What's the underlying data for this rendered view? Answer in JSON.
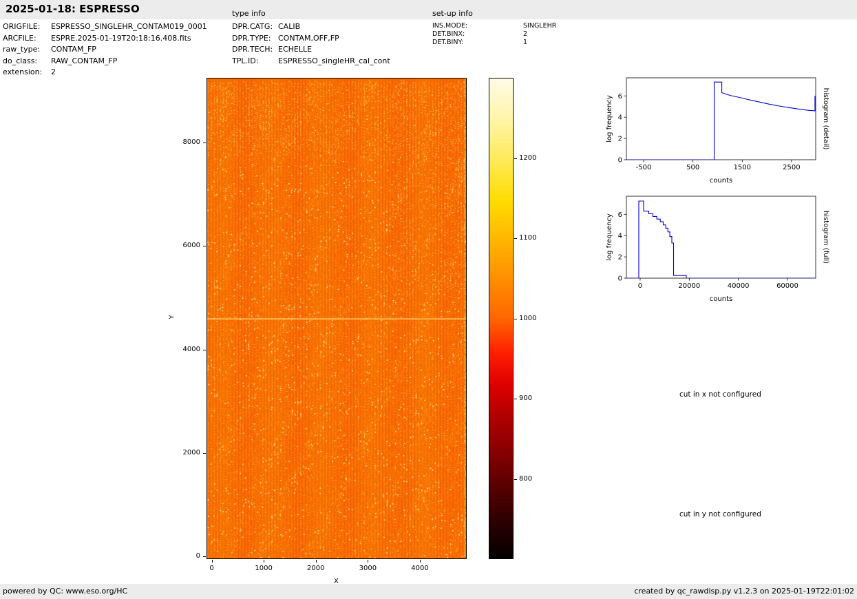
{
  "header": {
    "title": "2025-01-18: ESPRESSO",
    "type_info_label": "type info",
    "setup_info_label": "set-up info"
  },
  "meta": {
    "file_info": [
      {
        "label": "ORIGFILE:",
        "value": "ESPRESSO_SINGLEHR_CONTAM019_0001"
      },
      {
        "label": "ARCFILE:",
        "value": "ESPRE.2025-01-19T20:18:16.408.fits"
      },
      {
        "label": "raw_type:",
        "value": "CONTAM_FP"
      },
      {
        "label": "do_class:",
        "value": "RAW_CONTAM_FP"
      },
      {
        "label": "extension:",
        "value": "2"
      }
    ],
    "type_info": [
      {
        "label": "DPR.CATG:",
        "value": "CALIB"
      },
      {
        "label": "DPR.TYPE:",
        "value": "CONTAM,OFF,FP"
      },
      {
        "label": "DPR.TECH:",
        "value": "ECHELLE"
      },
      {
        "label": "TPL.ID:",
        "value": "ESPRESSO_singleHR_cal_cont"
      }
    ],
    "setup_info": [
      {
        "label": "INS.MODE:",
        "value": "SINGLEHR"
      },
      {
        "label": "DET.BINX:",
        "value": "2"
      },
      {
        "label": "DET.BINY:",
        "value": "1"
      }
    ]
  },
  "notes": {
    "cut_x": "cut in x not configured",
    "cut_y": "cut in y not configured"
  },
  "footer": {
    "left": "powered by QC: www.eso.org/HC",
    "right": "created by qc_rawdisp.py v1.2.3 on 2025-01-19T22:01:02"
  },
  "chart_data": [
    {
      "type": "heatmap",
      "name": "raw detector image",
      "xlabel": "X",
      "ylabel": "Y",
      "xlim": [
        -100,
        4900
      ],
      "ylim": [
        -50,
        9250
      ],
      "xticks": [
        0,
        1000,
        2000,
        3000,
        4000
      ],
      "yticks": [
        0,
        2000,
        4000,
        6000,
        8000
      ],
      "colormap": "hot",
      "colorbar_ticks": [
        800,
        900,
        1000,
        1100,
        1200
      ],
      "colorbar_range": [
        700,
        1300
      ],
      "field_color": "#f86c00",
      "content": "raw CONTAM_FP echelle frame, mostly ~1000 counts (orange) with vertical dotted Fabry-Perot tracks forming moire arcs, a bright horizontal row near y=4600 and a brighter rightmost column"
    },
    {
      "type": "line",
      "name": "histogram (detail)",
      "xlabel": "counts",
      "ylabel": "log frequency",
      "ylabel_right": "histogram (detail)",
      "color": "#0000cc",
      "grid": false,
      "xlim": [
        -850,
        2990
      ],
      "ylim": [
        0,
        7.7
      ],
      "xticks": [
        -500,
        500,
        1500,
        2500
      ],
      "yticks": [
        0,
        2,
        4,
        6
      ],
      "points": [
        [
          -850,
          0
        ],
        [
          930,
          0
        ],
        [
          930,
          7.3
        ],
        [
          1085,
          7.3
        ],
        [
          1085,
          6.3
        ],
        [
          1250,
          6.05
        ],
        [
          1450,
          5.85
        ],
        [
          1650,
          5.62
        ],
        [
          1850,
          5.42
        ],
        [
          2050,
          5.22
        ],
        [
          2250,
          5.05
        ],
        [
          2450,
          4.9
        ],
        [
          2650,
          4.76
        ],
        [
          2850,
          4.64
        ],
        [
          2975,
          4.6
        ],
        [
          2975,
          5.95
        ],
        [
          2990,
          5.95
        ]
      ]
    },
    {
      "type": "line",
      "name": "histogram (full)",
      "xlabel": "counts",
      "ylabel": "log frequency",
      "ylabel_right": "histogram (full)",
      "color": "#0000cc",
      "grid": false,
      "xlim": [
        -5600,
        71500
      ],
      "ylim": [
        0,
        7.7
      ],
      "xticks": [
        0,
        20000,
        40000,
        60000
      ],
      "yticks": [
        0,
        2,
        4,
        6
      ],
      "points": [
        [
          -5600,
          0
        ],
        [
          -550,
          0
        ],
        [
          -550,
          7.25
        ],
        [
          1400,
          7.25
        ],
        [
          1400,
          6.3
        ],
        [
          3500,
          6.3
        ],
        [
          3500,
          6.05
        ],
        [
          5200,
          6.05
        ],
        [
          5200,
          5.8
        ],
        [
          6800,
          5.8
        ],
        [
          6800,
          5.55
        ],
        [
          8200,
          5.55
        ],
        [
          8200,
          5.3
        ],
        [
          9400,
          5.3
        ],
        [
          9400,
          5.0
        ],
        [
          10400,
          5.0
        ],
        [
          10400,
          4.7
        ],
        [
          11300,
          4.7
        ],
        [
          11300,
          4.35
        ],
        [
          12100,
          4.35
        ],
        [
          12100,
          3.9
        ],
        [
          12900,
          3.9
        ],
        [
          12900,
          3.3
        ],
        [
          13600,
          3.3
        ],
        [
          13600,
          0.25
        ],
        [
          18800,
          0.25
        ],
        [
          18800,
          0
        ],
        [
          71500,
          0
        ]
      ]
    }
  ]
}
